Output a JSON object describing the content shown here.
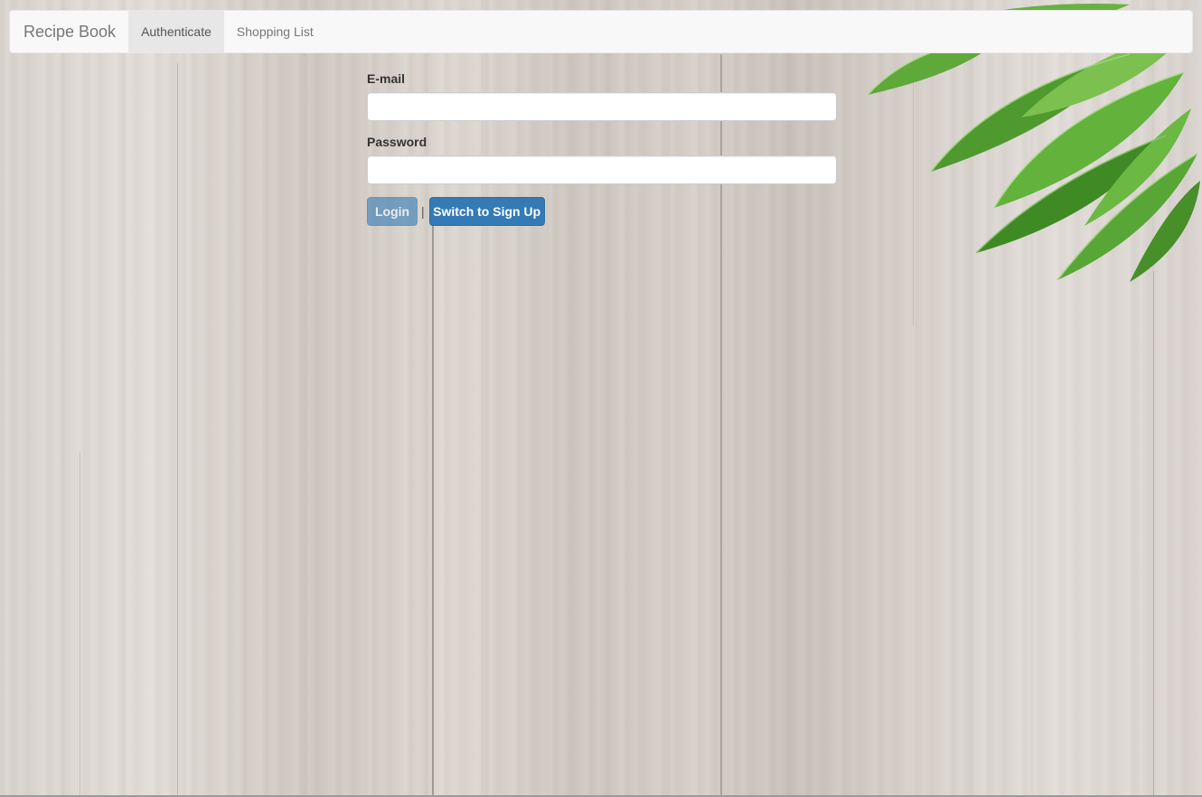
{
  "navbar": {
    "brand": "Recipe Book",
    "items": [
      {
        "label": "Authenticate",
        "active": true
      },
      {
        "label": "Shopping List",
        "active": false
      }
    ]
  },
  "form": {
    "email_label": "E-mail",
    "email_value": "",
    "password_label": "Password",
    "password_value": "",
    "login_label": "Login",
    "separator": "|",
    "switch_label": "Switch to Sign Up"
  },
  "colors": {
    "primary": "#337ab7",
    "navbar_bg": "#f8f8f8",
    "active_tab_bg": "#e7e7e7"
  }
}
